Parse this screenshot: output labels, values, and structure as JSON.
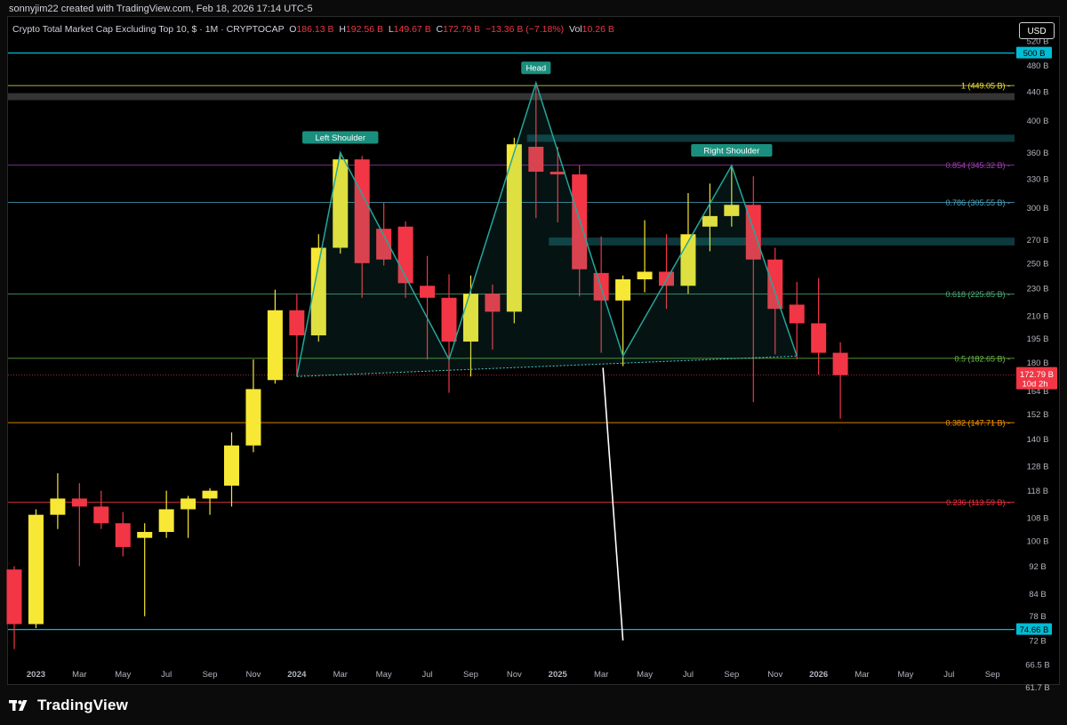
{
  "header": {
    "created_text": "sonnyjim22 created with TradingView.com, Feb 18, 2026 17:14 UTC-5",
    "symbol": "Crypto Total Market Cap Excluding Top 10, $ · 1M · CRYPTOCAP",
    "open_label": "O",
    "open": "186.13 B",
    "high_label": "H",
    "high": "192.56 B",
    "low_label": "L",
    "low": "149.67 B",
    "close_label": "C",
    "close": "172.79 B",
    "change": "−13.36 B (−7.18%)",
    "vol_label": "Vol",
    "vol": "10.26 B",
    "currency": "USD"
  },
  "footer": {
    "brand": "TradingView"
  },
  "colors": {
    "background": "#000000",
    "bull": "#f7e835",
    "bear": "#f23645",
    "pattern": "#26a69a",
    "neckline": "#4dd0c4",
    "cyan": "#00bcd4",
    "forecast": "#ffffff"
  },
  "chart_data": {
    "type": "candlestick",
    "interval": "1M",
    "scale": "log",
    "ylim": [
      58,
      540
    ],
    "y_ticks": [
      "520 B",
      "480 B",
      "440 B",
      "400 B",
      "360 B",
      "330 B",
      "300 B",
      "270 B",
      "250 B",
      "230 B",
      "210 B",
      "195 B",
      "180 B",
      "164 B",
      "152 B",
      "140 B",
      "128 B",
      "118 B",
      "108 B",
      "100 B",
      "92 B",
      "84 B",
      "78 B",
      "72 B",
      "66.5 B",
      "61.7 B"
    ],
    "x_labels": [
      "2023",
      "Mar",
      "May",
      "Jul",
      "Sep",
      "Nov",
      "2024",
      "Mar",
      "May",
      "Jul",
      "Sep",
      "Nov",
      "2025",
      "Mar",
      "May",
      "Jul",
      "Sep",
      "Nov",
      "2026",
      "Mar",
      "May",
      "Jul",
      "Sep"
    ],
    "x_label_months": [
      "2023-01",
      "2023-03",
      "2023-05",
      "2023-07",
      "2023-09",
      "2023-11",
      "2024-01",
      "2024-03",
      "2024-05",
      "2024-07",
      "2024-09",
      "2024-11",
      "2025-01",
      "2025-03",
      "2025-05",
      "2025-07",
      "2025-09",
      "2025-11",
      "2026-01",
      "2026-03",
      "2026-05",
      "2026-07",
      "2026-09"
    ],
    "candles": [
      {
        "t": "2022-12",
        "o": 91,
        "h": 92,
        "l": 70,
        "c": 76
      },
      {
        "t": "2023-01",
        "o": 76,
        "h": 111,
        "l": 75,
        "c": 109
      },
      {
        "t": "2023-02",
        "o": 109,
        "h": 125,
        "l": 104,
        "c": 115
      },
      {
        "t": "2023-03",
        "o": 115,
        "h": 121,
        "l": 92,
        "c": 112
      },
      {
        "t": "2023-04",
        "o": 112,
        "h": 118,
        "l": 104,
        "c": 106
      },
      {
        "t": "2023-05",
        "o": 106,
        "h": 110,
        "l": 95,
        "c": 98
      },
      {
        "t": "2023-06",
        "o": 101,
        "h": 106,
        "l": 78,
        "c": 103
      },
      {
        "t": "2023-07",
        "o": 103,
        "h": 118,
        "l": 101,
        "c": 111
      },
      {
        "t": "2023-08",
        "o": 111,
        "h": 116,
        "l": 101,
        "c": 115
      },
      {
        "t": "2023-09",
        "o": 115,
        "h": 119,
        "l": 109,
        "c": 118
      },
      {
        "t": "2023-10",
        "o": 120,
        "h": 143,
        "l": 112,
        "c": 137
      },
      {
        "t": "2023-11",
        "o": 137,
        "h": 182,
        "l": 134,
        "c": 165
      },
      {
        "t": "2023-12",
        "o": 170,
        "h": 229,
        "l": 168,
        "c": 214
      },
      {
        "t": "2024-01",
        "o": 214,
        "h": 226,
        "l": 172,
        "c": 197
      },
      {
        "t": "2024-02",
        "o": 197,
        "h": 275,
        "l": 193,
        "c": 263
      },
      {
        "t": "2024-03",
        "o": 263,
        "h": 360,
        "l": 258,
        "c": 352
      },
      {
        "t": "2024-04",
        "o": 352,
        "h": 356,
        "l": 223,
        "c": 250
      },
      {
        "t": "2024-05",
        "o": 280,
        "h": 305,
        "l": 248,
        "c": 253
      },
      {
        "t": "2024-06",
        "o": 282,
        "h": 287,
        "l": 223,
        "c": 234
      },
      {
        "t": "2024-07",
        "o": 232,
        "h": 256,
        "l": 182,
        "c": 223
      },
      {
        "t": "2024-08",
        "o": 223,
        "h": 241,
        "l": 163,
        "c": 193
      },
      {
        "t": "2024-09",
        "o": 193,
        "h": 240,
        "l": 172,
        "c": 226
      },
      {
        "t": "2024-10",
        "o": 226,
        "h": 233,
        "l": 188,
        "c": 213
      },
      {
        "t": "2024-11",
        "o": 213,
        "h": 378,
        "l": 205,
        "c": 370
      },
      {
        "t": "2024-12",
        "o": 367,
        "h": 453,
        "l": 290,
        "c": 338
      },
      {
        "t": "2025-01",
        "o": 338,
        "h": 367,
        "l": 286,
        "c": 335
      },
      {
        "t": "2025-02",
        "o": 335,
        "h": 345,
        "l": 224,
        "c": 245
      },
      {
        "t": "2025-03",
        "o": 242,
        "h": 273,
        "l": 186,
        "c": 221
      },
      {
        "t": "2025-04",
        "o": 221,
        "h": 240,
        "l": 178,
        "c": 237
      },
      {
        "t": "2025-05",
        "o": 237,
        "h": 288,
        "l": 227,
        "c": 243
      },
      {
        "t": "2025-06",
        "o": 243,
        "h": 275,
        "l": 215,
        "c": 232
      },
      {
        "t": "2025-07",
        "o": 232,
        "h": 315,
        "l": 226,
        "c": 275
      },
      {
        "t": "2025-08",
        "o": 282,
        "h": 325,
        "l": 260,
        "c": 292
      },
      {
        "t": "2025-09",
        "o": 292,
        "h": 345,
        "l": 282,
        "c": 303
      },
      {
        "t": "2025-10",
        "o": 303,
        "h": 333,
        "l": 158,
        "c": 253
      },
      {
        "t": "2025-11",
        "o": 253,
        "h": 263,
        "l": 185,
        "c": 215
      },
      {
        "t": "2025-12",
        "o": 218,
        "h": 235,
        "l": 182,
        "c": 205
      },
      {
        "t": "2026-01",
        "o": 205,
        "h": 238,
        "l": 173,
        "c": 186
      },
      {
        "t": "2026-02",
        "o": 186,
        "h": 192.56,
        "l": 149.67,
        "c": 172.79
      }
    ],
    "fib_levels": [
      {
        "label": "1 (449.05 B)",
        "value": 449.05,
        "color": "#f5e63c"
      },
      {
        "label": "0.854 (345.32 B)",
        "value": 345.32,
        "color": "#a63dbf"
      },
      {
        "label": "0.786 (305.55 B)",
        "value": 305.55,
        "color": "#4fa8c5"
      },
      {
        "label": "0.618 (225.85 B)",
        "value": 225.85,
        "color": "#4caf7a"
      },
      {
        "label": "0.5 (182.65 B)",
        "value": 182.65,
        "color": "#6fbf4a"
      },
      {
        "label": "0.382 (147.71 B)",
        "value": 147.71,
        "color": "#ff9800"
      },
      {
        "label": "0.236 (113.59 B)",
        "value": 113.59,
        "color": "#f23645"
      }
    ],
    "horizontal_lines": [
      {
        "value": 500,
        "label": "500 B",
        "color": "#00bcd4"
      },
      {
        "value": 74.66,
        "label": "74.66 B",
        "color": "#00bcd4"
      }
    ],
    "zones": [
      {
        "from": "2022-12",
        "to": "2026-09",
        "low": 428,
        "high": 438,
        "color": "#3a3a3a"
      },
      {
        "from": "2024-12",
        "to": "2026-09",
        "low": 373,
        "high": 382,
        "color": "#0e3e42"
      },
      {
        "from": "2025-01",
        "to": "2026-09",
        "low": 265,
        "high": 272,
        "color": "#0e3e42"
      }
    ],
    "pattern": {
      "labels": [
        "Left Shoulder",
        "Head",
        "Right Shoulder"
      ],
      "points": [
        {
          "t": "2024-01",
          "v": 172
        },
        {
          "t": "2024-03",
          "v": 360
        },
        {
          "t": "2024-08",
          "v": 182
        },
        {
          "t": "2024-12",
          "v": 453
        },
        {
          "t": "2025-04",
          "v": 184
        },
        {
          "t": "2025-09",
          "v": 345
        },
        {
          "t": "2025-12",
          "v": 184
        }
      ]
    },
    "forecast_line": [
      {
        "t": "2025-03",
        "v": 177
      },
      {
        "t": "2025-04",
        "v": 72
      }
    ],
    "last_price_label": "172.79 B",
    "countdown": "10d 2h"
  }
}
